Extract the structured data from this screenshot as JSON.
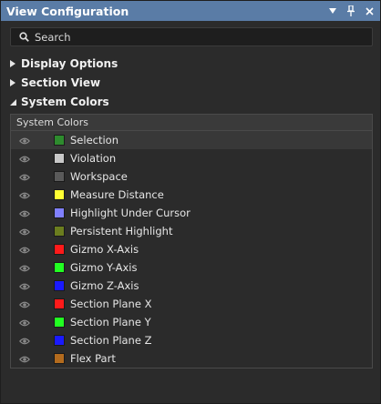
{
  "window": {
    "title": "View Configuration"
  },
  "search": {
    "placeholder": "Search"
  },
  "sections": [
    {
      "label": "Display Options",
      "expanded": false
    },
    {
      "label": "Section View",
      "expanded": false
    },
    {
      "label": "System Colors",
      "expanded": true
    }
  ],
  "system_colors": {
    "header": "System Colors",
    "items": [
      {
        "name": "Selection",
        "color": "#2e8b2e"
      },
      {
        "name": "Violation",
        "color": "#c8c8c8"
      },
      {
        "name": "Workspace",
        "color": "#5a5a5a"
      },
      {
        "name": "Measure Distance",
        "color": "#ffff33"
      },
      {
        "name": "Highlight Under Cursor",
        "color": "#8080ff"
      },
      {
        "name": "Persistent Highlight",
        "color": "#6b7d1f"
      },
      {
        "name": "Gizmo X-Axis",
        "color": "#ff1a1a"
      },
      {
        "name": "Gizmo Y-Axis",
        "color": "#22ff22"
      },
      {
        "name": "Gizmo Z-Axis",
        "color": "#1a1aff"
      },
      {
        "name": "Section Plane X",
        "color": "#ff1a1a"
      },
      {
        "name": "Section Plane Y",
        "color": "#22ff22"
      },
      {
        "name": "Section Plane Z",
        "color": "#1a1aff"
      },
      {
        "name": "Flex Part",
        "color": "#b36b1e"
      }
    ]
  },
  "colors": {
    "titlebar": "#5a7ca6",
    "background": "#2b2b2b"
  }
}
